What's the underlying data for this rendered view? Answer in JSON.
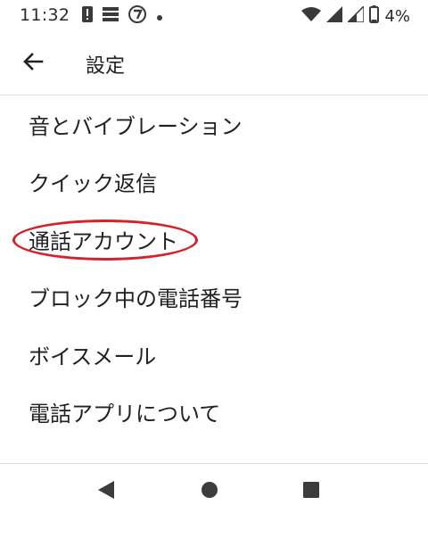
{
  "status_bar": {
    "time": "11:32",
    "battery": "4%",
    "left_icons": [
      "alert-icon",
      "storage-icon",
      "seven-eleven-app-icon",
      "dot-icon"
    ],
    "right_icons": [
      "wifi-icon",
      "cellular-signal-icon",
      "cellular-signal-2-icon",
      "battery-icon"
    ]
  },
  "app_bar": {
    "title": "設定",
    "back_icon": "arrow-back-icon"
  },
  "settings": {
    "items": [
      {
        "label": "音とバイブレーション"
      },
      {
        "label": "クイック返信"
      },
      {
        "label": "通話アカウント"
      },
      {
        "label": "ブロック中の電話番号"
      },
      {
        "label": "ボイスメール"
      },
      {
        "label": "電話アプリについて"
      }
    ],
    "highlighted_index": 2
  },
  "annotation": {
    "color": "#d8202a"
  },
  "nav_bar": {
    "buttons": [
      "back-triangle-icon",
      "home-circle-icon",
      "recents-square-icon"
    ]
  }
}
